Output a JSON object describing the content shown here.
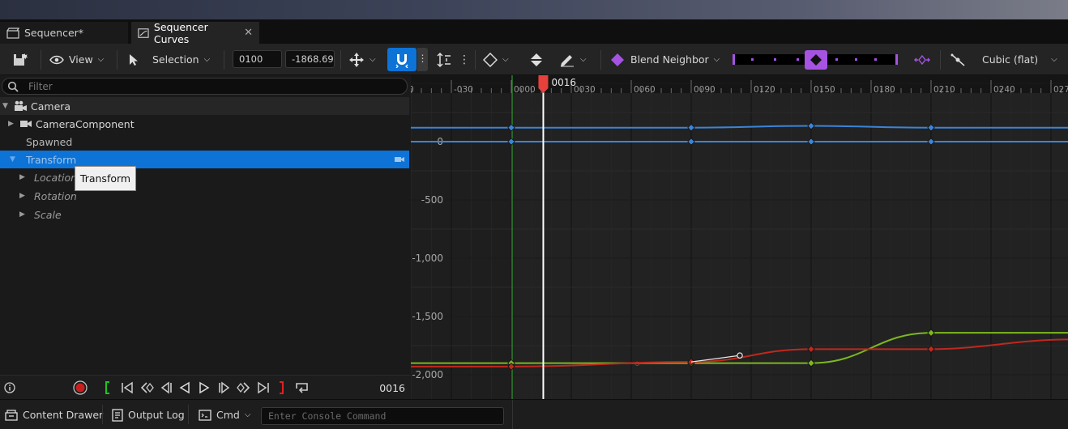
{
  "tabs": [
    {
      "label": "Sequencer*",
      "icon": "clapperboard-icon"
    },
    {
      "label": "Sequencer Curves",
      "icon": "curve-editor-icon",
      "close": "✕"
    }
  ],
  "toolbar": {
    "view_label": "View",
    "selection_label": "Selection",
    "time_value": "0100",
    "value_value": "-1868.69",
    "blend_label": "Blend Neighbor",
    "interp_label": "Cubic (flat)"
  },
  "outliner": {
    "filter_placeholder": "Filter",
    "items": [
      {
        "label": "Camera"
      },
      {
        "label": "CameraComponent"
      },
      {
        "label": "Spawned"
      },
      {
        "label": "Transform"
      },
      {
        "label": "Location"
      },
      {
        "label": "Rotation"
      },
      {
        "label": "Scale"
      }
    ],
    "tooltip": "Transform"
  },
  "transport": {
    "current_frame": "0016"
  },
  "timeline": {
    "playhead_label": "0016",
    "ticks": [
      "-030",
      "0000",
      "0030",
      "0060",
      "0090",
      "0120",
      "0150",
      "0180",
      "0210",
      "0240",
      "027"
    ]
  },
  "chart_data": {
    "type": "line",
    "y_ticks": [
      "0",
      "-500",
      "-1,000",
      "-1,500",
      "-2,000"
    ],
    "series": [
      {
        "color": "#3b84d8",
        "keys_x": [
          0,
          90,
          150,
          210
        ],
        "values": [
          120,
          120,
          135,
          120
        ]
      },
      {
        "color": "#3b84d8",
        "keys_x": [
          0,
          90,
          150,
          210
        ],
        "values": [
          0,
          0,
          0,
          0
        ]
      },
      {
        "color": "#7cb81e",
        "keys_x": [
          0,
          90,
          150,
          210
        ],
        "values": [
          -1900,
          -1900,
          -1900,
          -1640
        ]
      },
      {
        "color": "#c0281e",
        "keys_x": [
          0,
          90,
          150,
          210
        ],
        "values": [
          -1930,
          -1890,
          -1780,
          -1780
        ]
      }
    ]
  },
  "statusbar": {
    "content_drawer": "Content Drawer",
    "output_log": "Output Log",
    "cmd": "Cmd",
    "console_placeholder": "Enter Console Command"
  },
  "colors": {
    "selection_blue": "#0d73d6",
    "playhead_red": "#e8403a",
    "accent_purple": "#a553e0"
  }
}
